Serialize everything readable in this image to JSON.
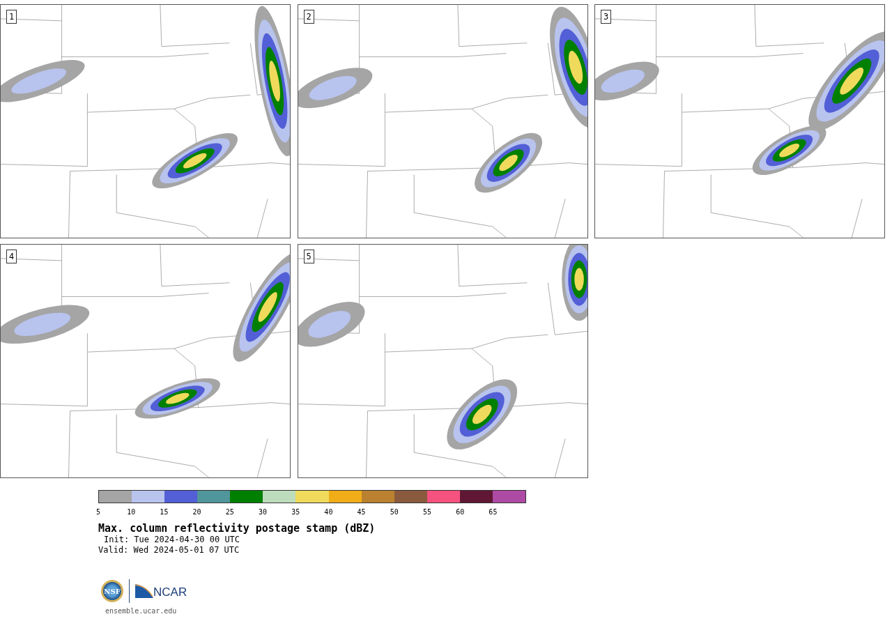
{
  "panels": [
    {
      "label": "1"
    },
    {
      "label": "2"
    },
    {
      "label": "3"
    },
    {
      "label": "4"
    },
    {
      "label": "5"
    }
  ],
  "colorbar": {
    "segments": [
      {
        "label": "5",
        "color": "#a5a5a5"
      },
      {
        "label": "10",
        "color": "#b8c3ee"
      },
      {
        "label": "15",
        "color": "#525fd6"
      },
      {
        "label": "20",
        "color": "#50969c"
      },
      {
        "label": "25",
        "color": "#008000"
      },
      {
        "label": "30",
        "color": "#bddcbc"
      },
      {
        "label": "35",
        "color": "#f0da5c"
      },
      {
        "label": "40",
        "color": "#f1ad18"
      },
      {
        "label": "45",
        "color": "#ba8230"
      },
      {
        "label": "50",
        "color": "#8a5a3e"
      },
      {
        "label": "55",
        "color": "#f5527f"
      },
      {
        "label": "60",
        "color": "#5f1734"
      },
      {
        "label": "65",
        "color": "#ad4aa4"
      }
    ]
  },
  "title": "Max. column reflectivity postage stamp (dBZ)",
  "init": "Init: Tue 2024-04-30 00 UTC",
  "valid": "Valid: Wed 2024-05-01 07 UTC",
  "logos": {
    "nsf": "NSF",
    "ncar": "NCAR"
  },
  "footer": "ensemble.ucar.edu"
}
